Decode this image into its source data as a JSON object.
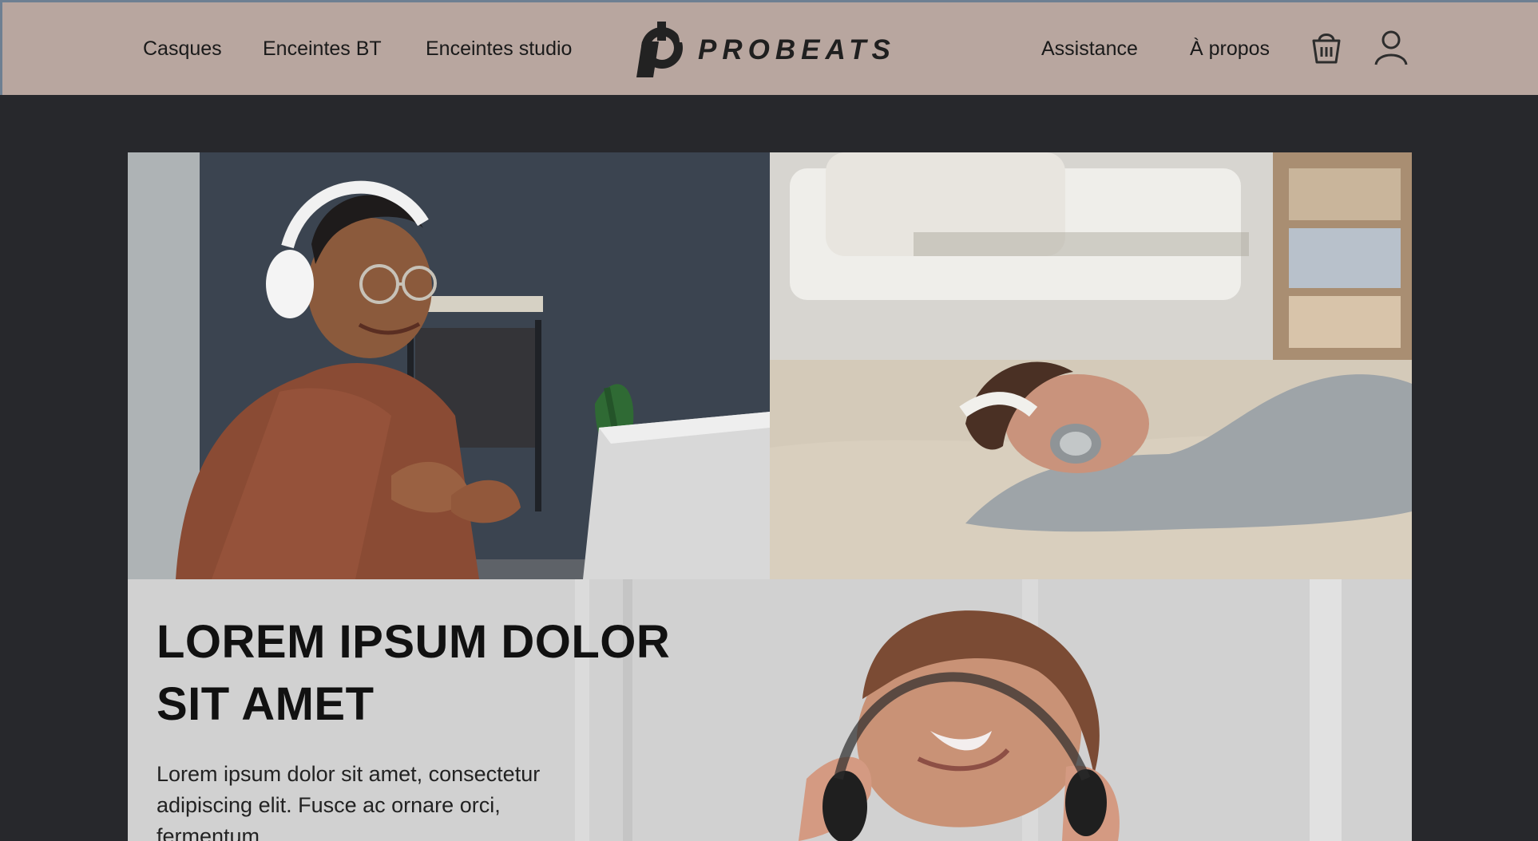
{
  "nav": {
    "left_links": [
      {
        "label": "Casques"
      },
      {
        "label": "Enceintes BT"
      },
      {
        "label": "Enceintes studio"
      }
    ],
    "right_links": [
      {
        "label": "Assistance"
      },
      {
        "label": "À propos"
      }
    ]
  },
  "brand": {
    "name": "PROBEATS",
    "logo_icon": "probeats-logo-icon"
  },
  "actions": {
    "cart_icon": "cart-icon",
    "account_icon": "user-icon"
  },
  "hero": {
    "headline_line_1": "LOREM IPSUM DOLOR",
    "headline_line_2": "SIT AMET",
    "body": "Lorem ipsum dolor sit amet, consectetur adipiscing elit. Fusce ac ornare orci, fermentum"
  },
  "colors": {
    "topbar": "#b8a69f",
    "page_background": "#27282c",
    "text_dark": "#111111"
  }
}
